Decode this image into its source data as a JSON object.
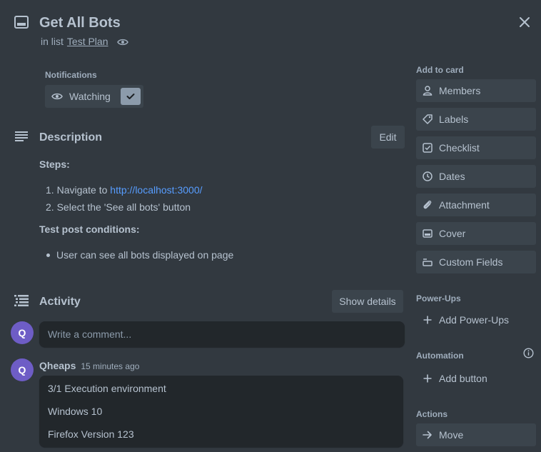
{
  "card": {
    "title": "Get All Bots",
    "in_list_prefix": "in list",
    "list_name": "Test Plan"
  },
  "notifications": {
    "label": "Notifications",
    "watch_label": "Watching",
    "watching": true
  },
  "description": {
    "title": "Description",
    "edit_label": "Edit",
    "steps_heading": "Steps:",
    "steps": [
      {
        "number": "1.",
        "text": "Navigate to ",
        "link": "http://localhost:3000/"
      },
      {
        "number": "2.",
        "text": "Select the 'See all bots' button"
      }
    ],
    "post_heading": "Test post conditions:",
    "post_conditions": [
      "User can see all bots displayed on page"
    ]
  },
  "activity": {
    "title": "Activity",
    "show_details_label": "Show details",
    "comment_placeholder": "Write a comment...",
    "current_user_initial": "Q",
    "comments": [
      {
        "initial": "Q",
        "author": "Qheaps",
        "time": "15 minutes ago",
        "lines": [
          "3/1 Execution environment",
          "Windows 10",
          "Firefox Version 123"
        ]
      }
    ]
  },
  "sidebar": {
    "add_to_card_heading": "Add to card",
    "add_to_card": [
      {
        "label": "Members",
        "icon": "person-icon"
      },
      {
        "label": "Labels",
        "icon": "tag-icon"
      },
      {
        "label": "Checklist",
        "icon": "checkbox-icon"
      },
      {
        "label": "Dates",
        "icon": "clock-icon"
      },
      {
        "label": "Attachment",
        "icon": "paperclip-icon"
      },
      {
        "label": "Cover",
        "icon": "cover-icon"
      },
      {
        "label": "Custom Fields",
        "icon": "custom-fields-icon"
      }
    ],
    "powerups_heading": "Power-Ups",
    "add_powerups_label": "Add Power-Ups",
    "automation_heading": "Automation",
    "add_button_label": "Add button",
    "actions_heading": "Actions",
    "move_label": "Move"
  },
  "colors": {
    "background": "#323940",
    "button": "#3b444c",
    "input": "#22272b",
    "text": "#b6c2cf",
    "subtle_text": "#9fadbc",
    "link": "#579dff",
    "avatar": "#6e5dc6"
  }
}
